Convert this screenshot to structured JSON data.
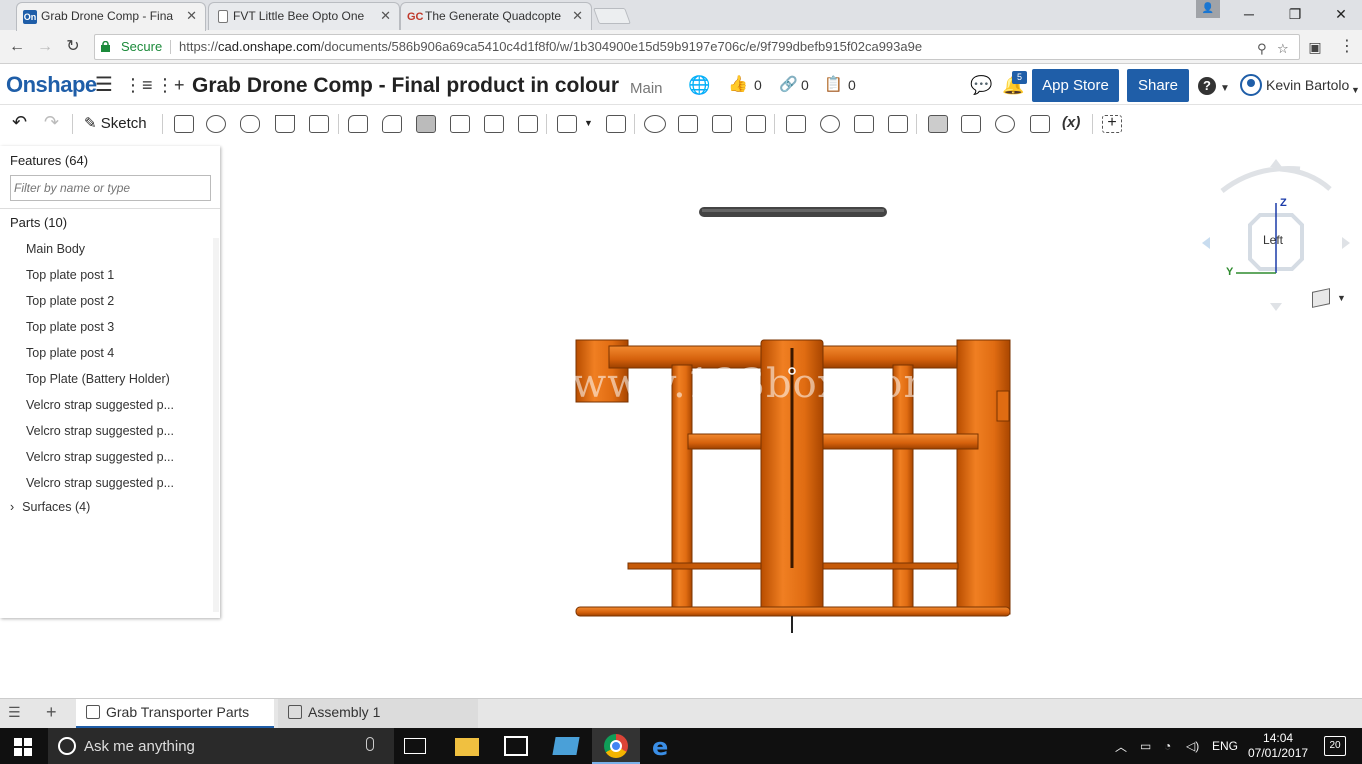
{
  "browser": {
    "tabs": [
      {
        "favicon": "On",
        "title": "Grab Drone Comp - Fina"
      },
      {
        "favicon": "doc",
        "title": "FVT Little Bee Opto One"
      },
      {
        "favicon": "GC",
        "title": "The Generate Quadcopte"
      }
    ],
    "secure_label": "Secure",
    "url_scheme": "https://",
    "url_domain": "cad.onshape.com",
    "url_path": "/documents/586b906a69ca5410c4d1f8f0/w/1b304900e15d59b9197e706c/e/9f799dbefb915f02ca993a9e"
  },
  "app": {
    "logo": "Onshape",
    "document_title": "Grab Drone Comp - Final product in colour",
    "branch": "Main",
    "likes": "0",
    "links": "0",
    "copies": "0",
    "notification_count": "5",
    "app_store_label": "App Store",
    "share_label": "Share",
    "help_label": "?",
    "user_name": "Kevin Bartolo"
  },
  "toolbar": {
    "sketch_label": "Sketch",
    "variables_label": "(x)"
  },
  "feature_panel": {
    "features_header": "Features (64)",
    "filter_placeholder": "Filter by name or type",
    "parts_header": "Parts (10)",
    "parts": [
      "Main Body",
      "Top plate post 1",
      "Top plate post 2",
      "Top plate post 3",
      "Top plate post 4",
      "Top Plate (Battery Holder)",
      "Velcro strap suggested p...",
      "Velcro strap suggested p...",
      "Velcro strap suggested p...",
      "Velcro strap suggested p..."
    ],
    "surfaces_label": "Surfaces (4)"
  },
  "viewport": {
    "view_name": "Left",
    "axis_z": "Z",
    "axis_y": "Y",
    "watermark": "www.123box.com",
    "model_color": "#e06c12"
  },
  "bottom_tabs": [
    {
      "label": "Grab Transporter Parts"
    },
    {
      "label": "Assembly 1"
    }
  ],
  "taskbar": {
    "search_placeholder": "Ask me anything",
    "language": "ENG",
    "time": "14:04",
    "date": "07/01/2017",
    "notification_count": "20"
  }
}
